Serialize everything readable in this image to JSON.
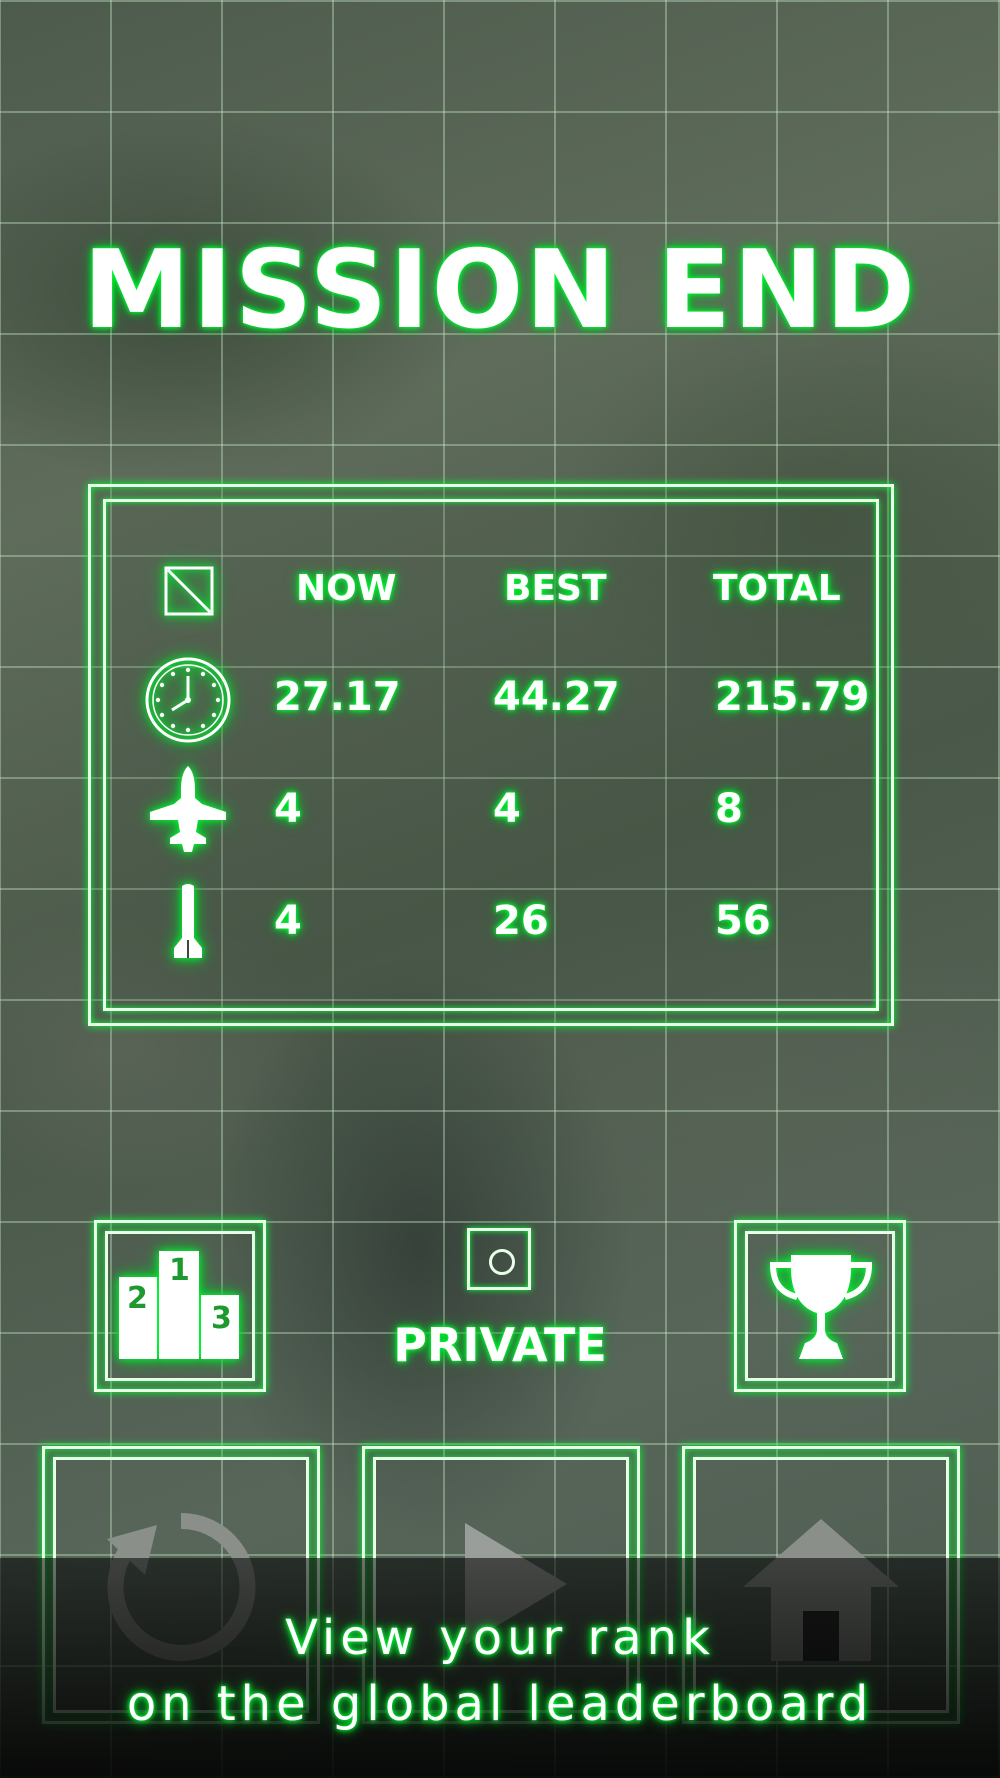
{
  "screen": {
    "title": "MISSION END"
  },
  "stats": {
    "header_icon": "square-slash-icon",
    "columns": [
      "NOW",
      "BEST",
      "TOTAL"
    ],
    "rows": [
      {
        "icon": "clock-icon",
        "now": "27.17",
        "best": "44.27",
        "total": "215.79"
      },
      {
        "icon": "fighter-jet-icon",
        "now": "4",
        "best": "4",
        "total": "8"
      },
      {
        "icon": "missile-icon",
        "now": "4",
        "best": "26",
        "total": "56"
      }
    ]
  },
  "actions": {
    "leaderboard_icon": "podium-icon",
    "podium_numbers": [
      "2",
      "1",
      "3"
    ],
    "privacy_label": "PRIVATE",
    "achievements_icon": "trophy-icon",
    "retry_icon": "restart-icon",
    "play_icon": "play-icon",
    "home_icon": "home-icon"
  },
  "banner": {
    "line1": "View your rank",
    "line2": "on the global leaderboard"
  },
  "colors": {
    "glow": "#00ff33",
    "text": "#ffffff"
  }
}
